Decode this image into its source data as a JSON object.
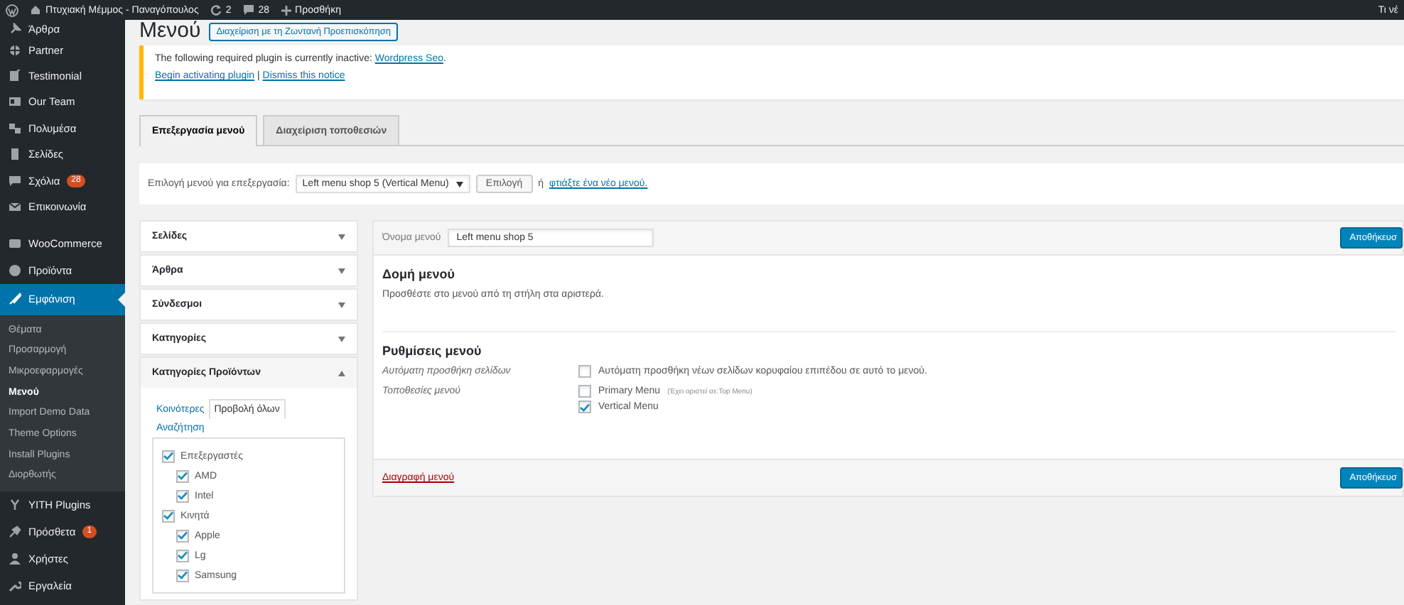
{
  "admin_bar": {
    "site_name": "Πτυχιακή Μέμμος - Παναγόπουλος",
    "updates": "2",
    "comments": "28",
    "new": "Προσθήκη",
    "right_text": "Τι νέ"
  },
  "sidebar": {
    "groups": [
      [
        {
          "label": "Άρθρα",
          "selected": false
        },
        {
          "label": "Partner",
          "selected": false
        },
        {
          "label": "Testimonial",
          "selected": false
        },
        {
          "label": "Our Team",
          "selected": false
        },
        {
          "label": "Πολυμέσα",
          "selected": false
        },
        {
          "label": "Σελίδες",
          "selected": false
        },
        {
          "label": "Σχόλια",
          "selected": false,
          "badge": "28"
        },
        {
          "label": "Επικοινωνία",
          "selected": false
        }
      ],
      [
        {
          "label": "WooCommerce",
          "selected": false
        },
        {
          "label": "Προϊόντα",
          "selected": false
        },
        {
          "label": "Εμφάνιση",
          "selected": true,
          "children": [
            {
              "label": "Θέματα",
              "selected": false
            },
            {
              "label": "Προσαρμογή",
              "selected": false
            },
            {
              "label": "Μικροεφαρμογές",
              "selected": false
            },
            {
              "label": "Μενού",
              "selected": true
            },
            {
              "label": "Import Demo Data",
              "selected": false
            },
            {
              "label": "Theme Options",
              "selected": false
            },
            {
              "label": "Install Plugins",
              "selected": false
            },
            {
              "label": "Διορθωτής",
              "selected": false
            }
          ]
        }
      ],
      [
        {
          "label": "YITH Plugins",
          "selected": false
        },
        {
          "label": "Πρόσθετα",
          "selected": false,
          "badge": "1"
        },
        {
          "label": "Χρήστες",
          "selected": false
        },
        {
          "label": "Εργαλεία",
          "selected": false
        }
      ]
    ]
  },
  "page": {
    "title": "Μενού",
    "title_action": "Διαχείριση με τη Ζωντανή Προεπισκόπηση"
  },
  "notice": {
    "message": "The following required plugin is currently inactive:",
    "plugin_link": "Wordpress Seo",
    "message_end": ".",
    "links": [
      "Begin activating plugin",
      "Dismiss this notice"
    ],
    "separator": "|"
  },
  "tabs": [
    {
      "label": "Επεξεργασία μενού",
      "selected": true
    },
    {
      "label": "Διαχείριση τοποθεσιών",
      "selected": false
    }
  ],
  "menu_select": {
    "label": "Επιλογή μενού για επεξεργασία:",
    "value": "Left menu shop 5 (Vertical Menu)",
    "button": "Επιλογή",
    "or": "ή",
    "create_link": "φτιάξτε ένα νέο μενού."
  },
  "add_items": {
    "sections": [
      {
        "title": "Σελίδες",
        "expanded": false
      },
      {
        "title": "Άρθρα",
        "expanded": false
      },
      {
        "title": "Σύνδεσμοι",
        "expanded": false
      },
      {
        "title": "Κατηγορίες",
        "expanded": false
      },
      {
        "title": "Κατηγορίες Προϊόντων",
        "expanded": true,
        "tabs": [
          {
            "label": "Κοινότερες",
            "selected": false
          },
          {
            "label": "Προβολή όλων",
            "selected": true
          },
          {
            "label": "Αναζήτηση",
            "selected": false
          }
        ],
        "items": [
          {
            "label": "Επεξεργαστές",
            "checked": true,
            "children": [
              {
                "label": "AMD",
                "checked": true
              },
              {
                "label": "Intel",
                "checked": true
              }
            ]
          },
          {
            "label": "Κινητά",
            "checked": true,
            "children": [
              {
                "label": "Apple",
                "checked": true
              },
              {
                "label": "Lg",
                "checked": true
              },
              {
                "label": "Samsung",
                "checked": true
              }
            ]
          }
        ]
      }
    ]
  },
  "menu_editor": {
    "name_label": "Όνομα μενού",
    "name_value": "Left menu shop 5",
    "save_button": "Αποθήκευσ",
    "structure_title": "Δομή μενού",
    "structure_hint": "Προσθέστε στο μενού από τη στήλη στα αριστερά.",
    "settings_title": "Ρυθμίσεις μενού",
    "settings": [
      {
        "label": "Αυτόματη προσθήκη σελίδων",
        "options": [
          {
            "label": "Αυτόματη προσθήκη νέων σελίδων κορυφαίου επιπέδου σε αυτό το μενού.",
            "checked": false
          }
        ]
      },
      {
        "label": "Τοποθεσίες μενού",
        "options": [
          {
            "label": "Primary Menu",
            "note": "(Έχει οριστεί σε:Top Menu)",
            "checked": false
          },
          {
            "label": "Vertical Menu",
            "checked": true
          }
        ]
      }
    ],
    "delete_link": "Διαγραφή μενού",
    "footer_save_button": "Αποθήκευσ"
  }
}
